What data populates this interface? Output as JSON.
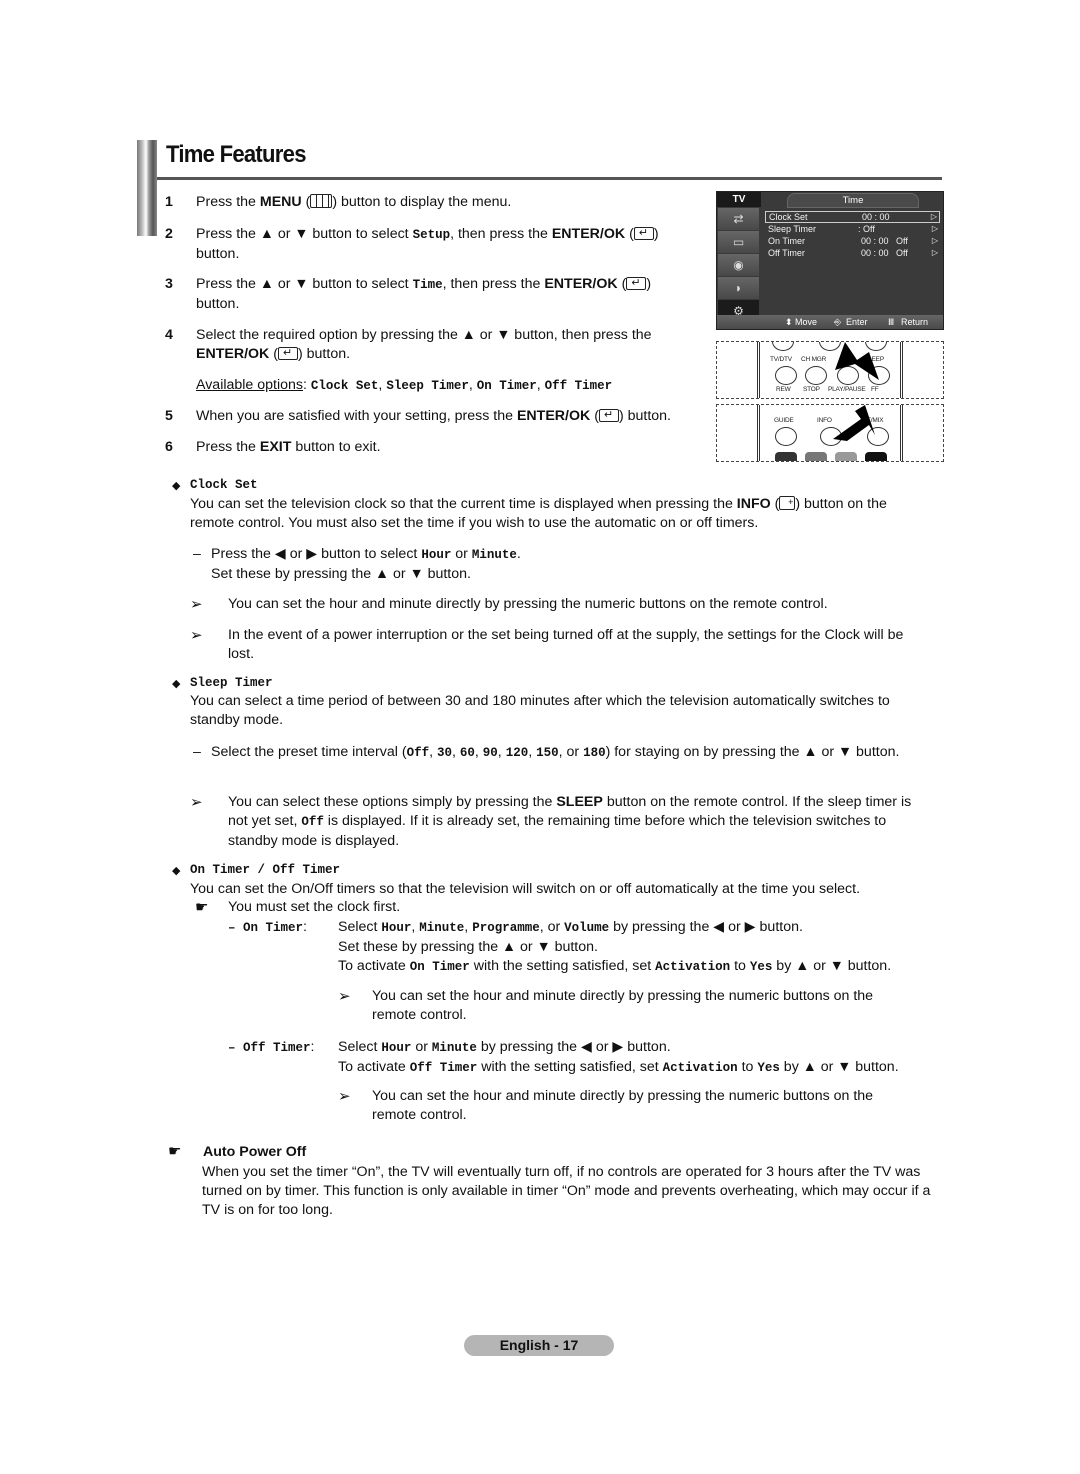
{
  "header": {
    "title": "Time Features"
  },
  "steps": [
    {
      "num": "1",
      "parts": [
        "Press the ",
        "MENU",
        " (",
        ") button to display the menu."
      ]
    },
    {
      "num": "2",
      "parts": [
        "Press the ▲ or ▼ button to select ",
        "Setup",
        ", then press the ",
        "ENTER/OK",
        " (",
        ")",
        "button."
      ]
    },
    {
      "num": "3",
      "parts": [
        "Press the ▲ or ▼ button to select ",
        "Time",
        ", then press the ",
        "ENTER/OK",
        " (",
        ")",
        "button."
      ]
    },
    {
      "num": "4",
      "parts": [
        "Select the required option by pressing the ▲ or ▼ button, then press the",
        "ENTER/OK",
        " (",
        ") button."
      ]
    },
    {
      "num": "5",
      "parts": [
        "When you are satisfied with your setting, press the ",
        "ENTER/OK",
        " (",
        ") button."
      ]
    },
    {
      "num": "6",
      "parts": [
        "Press the ",
        "EXIT",
        " button to exit."
      ]
    }
  ],
  "available_options": {
    "label": "Available options",
    "sep": ": ",
    "items": [
      "Clock Set",
      "Sleep Timer",
      "On Timer",
      "Off Timer"
    ]
  },
  "osd": {
    "tv_tab": "TV",
    "title": "Time",
    "side_icons": [
      "input-icon",
      "picture-icon",
      "sound-icon",
      "channel-icon",
      "setup-icon"
    ],
    "rows": [
      {
        "label": "Clock Set",
        "value": "00 : 00",
        "arrow": "▷",
        "selected": true
      },
      {
        "label": "Sleep Timer",
        "value": ": Off",
        "arrow": "▷",
        "selected": false
      },
      {
        "label": "On Timer",
        "value": "00 : 00   Off",
        "arrow": "▷",
        "selected": false
      },
      {
        "label": "Off Timer",
        "value": "00 : 00   Off",
        "arrow": "▷",
        "selected": false
      }
    ],
    "footer": {
      "move": "Move",
      "enter": "Enter",
      "return": "Return"
    }
  },
  "remote1": {
    "labels": [
      "TV/DTV",
      "CH MGR",
      "SLEEP",
      "REW",
      "STOP",
      "PLAY/PAUSE",
      "FF"
    ]
  },
  "remote2": {
    "labels": [
      "GUIDE",
      "INFO",
      "T/MIX"
    ]
  },
  "sections": {
    "clock_set": {
      "title": "Clock Set",
      "body_a": "You can set the television clock so that the current time is displayed when pressing the ",
      "body_bold": "INFO",
      "body_b": " (",
      "body_c": ") button on the",
      "body_line2": "remote control. You must also set the time if you wish to use the automatic on or off timers.",
      "dash_a": "Press the ◀ or ▶ button to select ",
      "dash_hour": "Hour",
      "dash_or": " or ",
      "dash_minute": "Minute",
      "dash_end": ".",
      "dash_line2": "Set these by pressing the ▲ or ▼ button.",
      "note1": "You can set the hour and minute directly by pressing the numeric buttons on the remote control.",
      "note2": "In the event of a power interruption or the set being turned off at the supply, the settings for the Clock will be lost."
    },
    "sleep_timer": {
      "title": "Sleep Timer",
      "body": "You can select a time period of between 30 and 180 minutes after which the television automatically switches to standby mode.",
      "dash_a": "Select the preset time interval (",
      "intervals": [
        "Off",
        "30",
        "60",
        "90",
        "120",
        "150",
        "180"
      ],
      "dash_end": ") for staying on by pressing the ▲ or ▼ button.",
      "note_a": "You can select these options simply by pressing the ",
      "note_bold": "SLEEP",
      "note_b": " button on the remote control. If the sleep timer is not yet set, ",
      "note_off": "Off",
      "note_c": " is displayed. If it is already set, the remaining time before which the television switches to standby mode is displayed."
    },
    "on_off_timer": {
      "title": "On Timer / Off Timer",
      "body": "You can set the On/Off timers so that the television will switch on or off automatically at the time you select.",
      "hint": "You must set the clock first.",
      "on_timer": {
        "label": "On Timer",
        "line1_a": "Select ",
        "items": [
          "Hour",
          "Minute",
          "Programme",
          "Volume"
        ],
        "line1_end": " by pressing the ◀ or ▶ button.",
        "line2": "Set these by pressing the ▲ or ▼ button.",
        "line3_a": "To activate ",
        "line3_code": "On Timer",
        "line3_b": " with the setting satisfied, set ",
        "line3_act": "Activation",
        "line3_to": " to ",
        "line3_yes": "Yes",
        "line3_end": " by ▲ or ▼ button.",
        "note": "You can set the hour and minute directly by pressing the numeric buttons on the remote control."
      },
      "off_timer": {
        "label": "Off Timer",
        "line1_a": "Select ",
        "hour": "Hour",
        "or": " or ",
        "minute": "Minute",
        "line1_end": " by pressing the ◀ or ▶ button.",
        "line2_a": "To activate ",
        "line2_code": "Off Timer",
        "line2_b": " with the setting satisfied, set ",
        "line2_act": "Activation",
        "line2_to": " to ",
        "line2_yes": "Yes",
        "line2_end": " by ▲ or ▼ button.",
        "note": "You can set the hour and minute directly by pressing the numeric buttons on the remote control."
      }
    },
    "auto_power_off": {
      "title": "Auto Power Off",
      "body": "When you set the timer “On”, the TV will eventually turn off, if no controls are operated for 3 hours after the TV was turned on by timer. This function is only available in timer “On” mode and prevents overheating, which may occur if a TV is on for too long."
    }
  },
  "footer": {
    "page_label": "English - 17"
  }
}
